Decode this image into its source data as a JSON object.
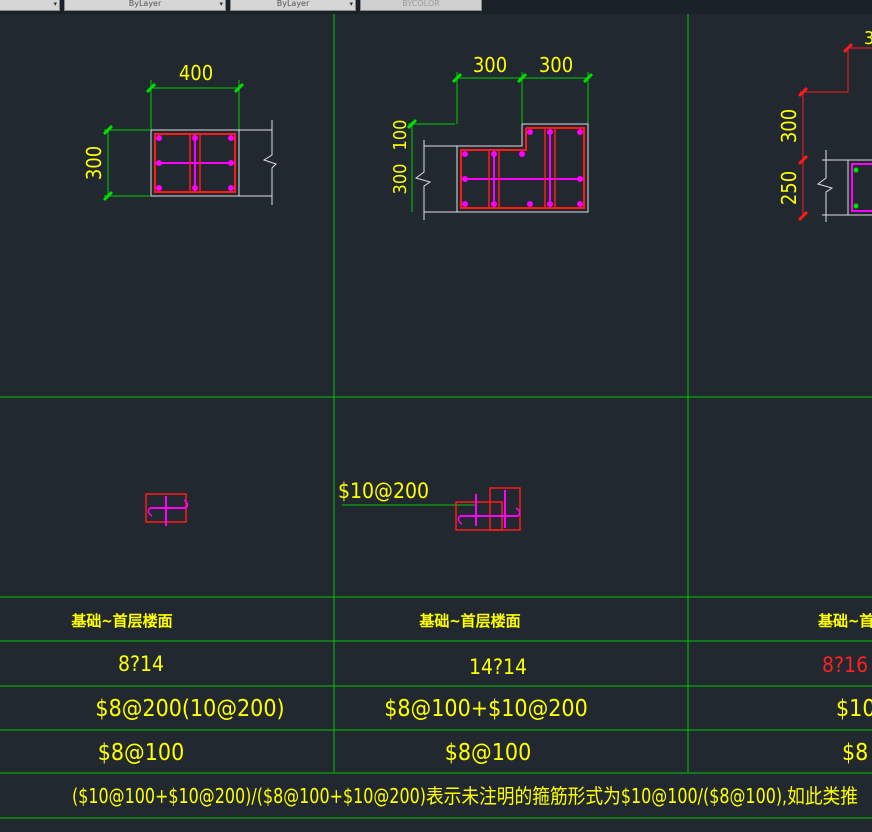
{
  "toolbar": {
    "layer_dropdown_1": "ByLayer",
    "layer_dropdown_2": "ByLayer",
    "color_dropdown": "BYCOLOR"
  },
  "section_1": {
    "dim_width": "400",
    "dim_height": "300"
  },
  "section_2": {
    "dim_width_left": "300",
    "dim_width_right": "300",
    "dim_height_top": "100",
    "dim_height_bottom": "300",
    "stirrup_label": "$10@200"
  },
  "section_3": {
    "dim_top": "3",
    "dim_height_top": "300",
    "dim_height_bottom": "250"
  },
  "table": {
    "elevation": [
      "基础~首层楼面",
      "基础~首层楼面",
      "基础~首层楼面"
    ],
    "longitudinal": [
      "8?14",
      "14?14",
      "8?16"
    ],
    "stirrup_main": [
      "$8@200(10@200)",
      "$8@100+$10@200",
      "$10"
    ],
    "stirrup_secondary": [
      "$8@100",
      "$8@100",
      "$8"
    ],
    "note": "($10@100+$10@200)/($8@100+$10@200)表示未注明的箍筋形式为$10@100/($8@100),如此类推"
  },
  "colors": {
    "background": "#212830",
    "grid_line": "#00c800",
    "dimension": "#00d000",
    "text_yellow": "#ffff00",
    "text_red": "#ff2020",
    "stirrup": "#ff00ff",
    "rebar_red": "#ff1a1a",
    "outline": "#e0e0e0"
  }
}
